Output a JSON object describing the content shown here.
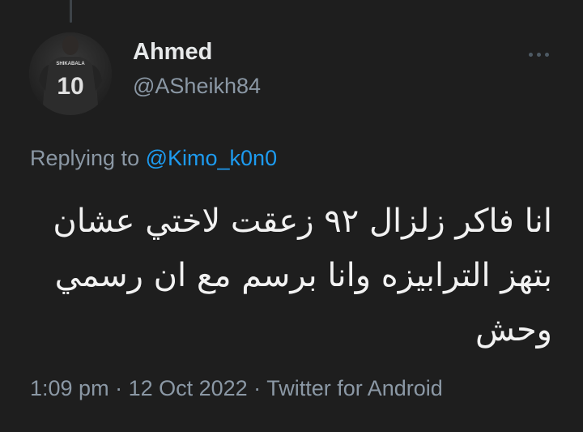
{
  "author": {
    "display_name": "Ahmed",
    "handle": "@ASheikh84",
    "avatar_icon": "avatar-player-jersey-icon",
    "jersey_name": "SHIKABALA",
    "jersey_number": "10"
  },
  "reply": {
    "prefix": "Replying to ",
    "mention": "@Kimo_k0n0"
  },
  "tweet": {
    "lines": [
      "انا فاكر زلزال ٩٢ زعقت لاختي عشان",
      "بتهز الترابيزه وانا برسم مع ان رسمي",
      "وحش"
    ]
  },
  "meta": {
    "time": "1:09 pm",
    "separator": " · ",
    "date": "12 Oct 2022",
    "source": "Twitter for Android"
  },
  "colors": {
    "background": "#1e1e1e",
    "text_primary": "#e7e9ea",
    "text_secondary": "#8b98a5",
    "link": "#1d9bf0"
  }
}
